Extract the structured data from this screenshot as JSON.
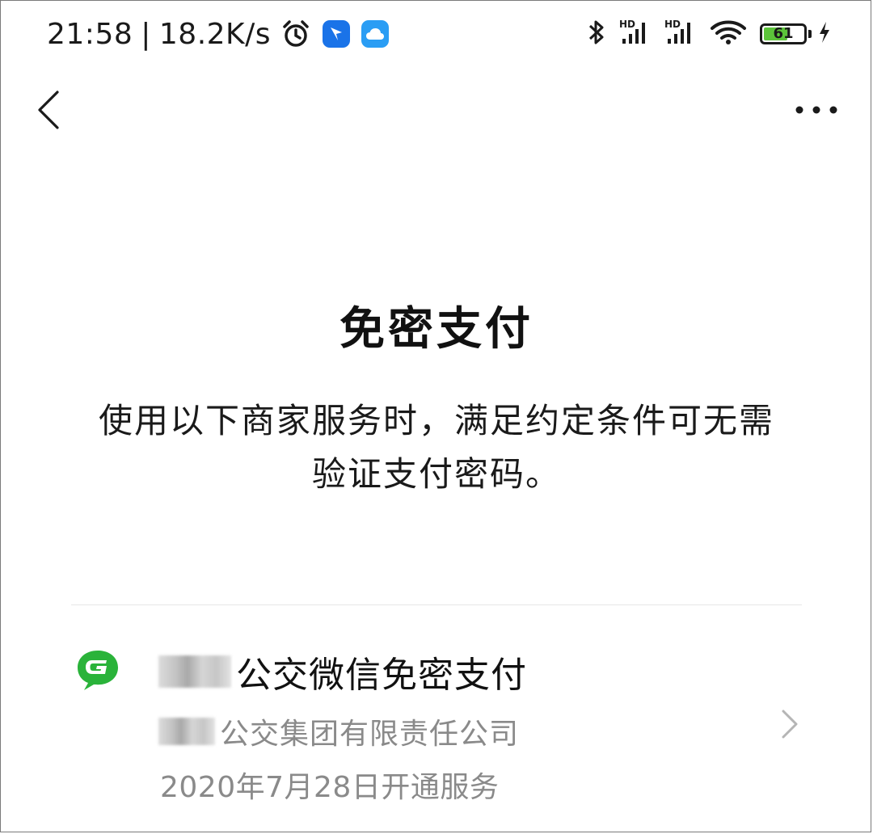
{
  "status_bar": {
    "time": "21:58",
    "separator": "|",
    "speed": "18.2K/s",
    "battery_level": "61",
    "battery_fraction": 0.61,
    "icons": [
      "alarm-icon",
      "app-badge-blue",
      "cloud-icon",
      "bluetooth-icon",
      "signal-hd-1-icon",
      "signal-hd-2-icon",
      "wifi-icon",
      "battery-icon",
      "charging-icon"
    ],
    "colors": {
      "battery_fill": "#5cc43a",
      "app_badge_1": "#1a73e8",
      "app_badge_2": "#2a9df4"
    }
  },
  "nav": {
    "back_icon": "chevron-left-icon",
    "more_icon": "more-horizontal-icon"
  },
  "page": {
    "title": "免密支付",
    "description_line1": "使用以下商家服务时，满足约定条件可无需",
    "description_line2": "验证支付密码。"
  },
  "service": {
    "logo_icon": "green-g-logo-icon",
    "logo_color": "#2ab33a",
    "title": "公交微信免密支付",
    "company": "公交集团有限责任公司",
    "date": "2020年7月28日开通服务",
    "chevron_icon": "chevron-right-icon"
  }
}
